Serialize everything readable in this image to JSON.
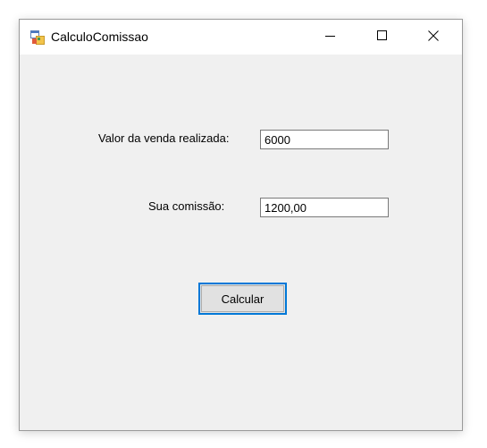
{
  "window": {
    "title": "CalculoComissao",
    "icon": "winforms-app-icon"
  },
  "titlebar_buttons": {
    "minimize_icon": "minimize-icon",
    "maximize_icon": "maximize-icon",
    "close_icon": "close-icon"
  },
  "form": {
    "venda_label": "Valor da venda realizada:",
    "venda_value": "6000",
    "comissao_label": "Sua comissão:",
    "comissao_value": "1200,00",
    "calcular_label": "Calcular"
  },
  "colors": {
    "client_background": "#f0f0f0",
    "button_focus_border": "#0078d7",
    "button_background": "#e1e1e1"
  }
}
